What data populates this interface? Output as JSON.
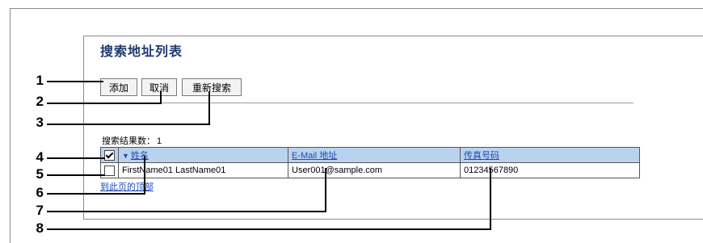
{
  "page": {
    "title": "搜索地址列表"
  },
  "toolbar": {
    "add_label": "添加",
    "cancel_label": "取消",
    "research_label": "重新搜索"
  },
  "results": {
    "count_label": "搜索结果数：",
    "count_value": "1"
  },
  "table": {
    "columns": {
      "name": "姓名",
      "email": "E-Mail 地址",
      "fax": "传真号码"
    },
    "sort_indicator": "▼",
    "header_checked": true,
    "rows": [
      {
        "checked": false,
        "name": "FirstName01 LastName01",
        "email": "User001@sample.com",
        "fax": "01234567890"
      }
    ]
  },
  "footer": {
    "back_link": "到此页的顶部"
  },
  "callouts": [
    "1",
    "2",
    "3",
    "4",
    "5",
    "6",
    "7",
    "8"
  ]
}
